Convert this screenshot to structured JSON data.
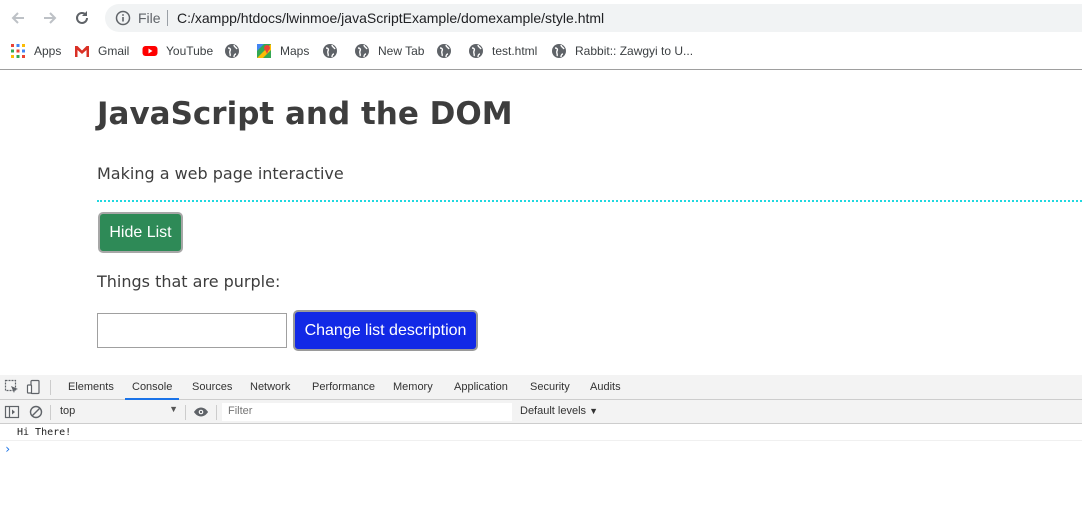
{
  "browser": {
    "address_scheme_label": "File",
    "url": "C:/xampp/htdocs/lwinmoe/javaScriptExample/domexample/style.html",
    "bookmarks": [
      {
        "label": "Apps",
        "icon": "apps-grid-icon"
      },
      {
        "label": "Gmail",
        "icon": "gmail-icon"
      },
      {
        "label": "YouTube",
        "icon": "youtube-icon"
      },
      {
        "label": "",
        "icon": "globe-icon"
      },
      {
        "label": "Maps",
        "icon": "maps-icon"
      },
      {
        "label": "",
        "icon": "globe-icon"
      },
      {
        "label": "New Tab",
        "icon": "globe-icon"
      },
      {
        "label": "",
        "icon": "globe-icon"
      },
      {
        "label": "test.html",
        "icon": "globe-icon"
      },
      {
        "label": "Rabbit:: Zawgyi to U...",
        "icon": "globe-icon"
      }
    ]
  },
  "page": {
    "title": "JavaScript and the DOM",
    "description": "Making a web page interactive",
    "hide_button": "Hide List",
    "purple_label": "Things that are purple:",
    "input_value": "",
    "change_button": "Change list description",
    "colors": {
      "hide_button_bg": "#2e8a57",
      "change_button_bg": "#1229e6",
      "dotted_rule": "#21d8e0",
      "text": "#3d3d3d"
    }
  },
  "devtools": {
    "tabs": [
      "Elements",
      "Console",
      "Sources",
      "Network",
      "Performance",
      "Memory",
      "Application",
      "Security",
      "Audits"
    ],
    "active_tab": "Console",
    "context": "top",
    "filter_placeholder": "Filter",
    "levels": "Default levels",
    "console_messages": [
      "Hi There!"
    ],
    "prompt_symbol": "›"
  }
}
